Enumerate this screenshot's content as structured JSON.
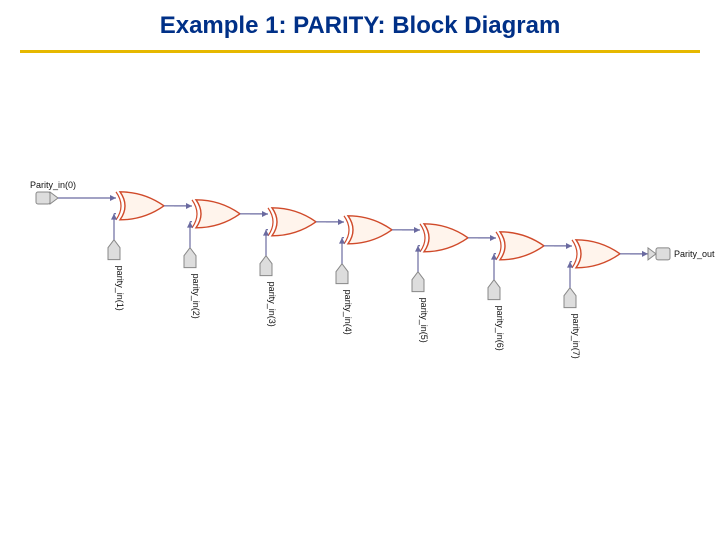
{
  "title": "Example 1: PARITY: Block Diagram",
  "input0_label": "Parity_in(0)",
  "output_label": "Parity_out",
  "stages": [
    {
      "in_label": "parity_in(1)"
    },
    {
      "in_label": "parity_in(2)"
    },
    {
      "in_label": "parity_in(3)"
    },
    {
      "in_label": "parity_in(4)"
    },
    {
      "in_label": "parity_in(5)"
    },
    {
      "in_label": "parity_in(6)"
    },
    {
      "in_label": "parity_in(7)"
    }
  ],
  "colors": {
    "title": "#003087",
    "rule": "#e6b800",
    "wire": "#6a6aa0",
    "gate_stroke": "#d04a2a",
    "gate_fill": "#fff4ec",
    "port_stroke": "#888",
    "port_fill": "#ddd"
  },
  "diagram_data": {
    "type": "block-diagram",
    "description": "Cascaded chain of seven 2-input XOR gates producing an 8-bit parity. Parity_in(0) feeds the first gate's top input; parity_in(1..7) feed successive second inputs; each gate's output feeds the next gate's top input; final output is Parity_out.",
    "gates": [
      {
        "kind": "XOR",
        "inputs": [
          "Parity_in(0)",
          "parity_in(1)"
        ],
        "output": "n1"
      },
      {
        "kind": "XOR",
        "inputs": [
          "n1",
          "parity_in(2)"
        ],
        "output": "n2"
      },
      {
        "kind": "XOR",
        "inputs": [
          "n2",
          "parity_in(3)"
        ],
        "output": "n3"
      },
      {
        "kind": "XOR",
        "inputs": [
          "n3",
          "parity_in(4)"
        ],
        "output": "n4"
      },
      {
        "kind": "XOR",
        "inputs": [
          "n4",
          "parity_in(5)"
        ],
        "output": "n5"
      },
      {
        "kind": "XOR",
        "inputs": [
          "n5",
          "parity_in(6)"
        ],
        "output": "n6"
      },
      {
        "kind": "XOR",
        "inputs": [
          "n6",
          "parity_in(7)"
        ],
        "output": "Parity_out"
      }
    ]
  }
}
